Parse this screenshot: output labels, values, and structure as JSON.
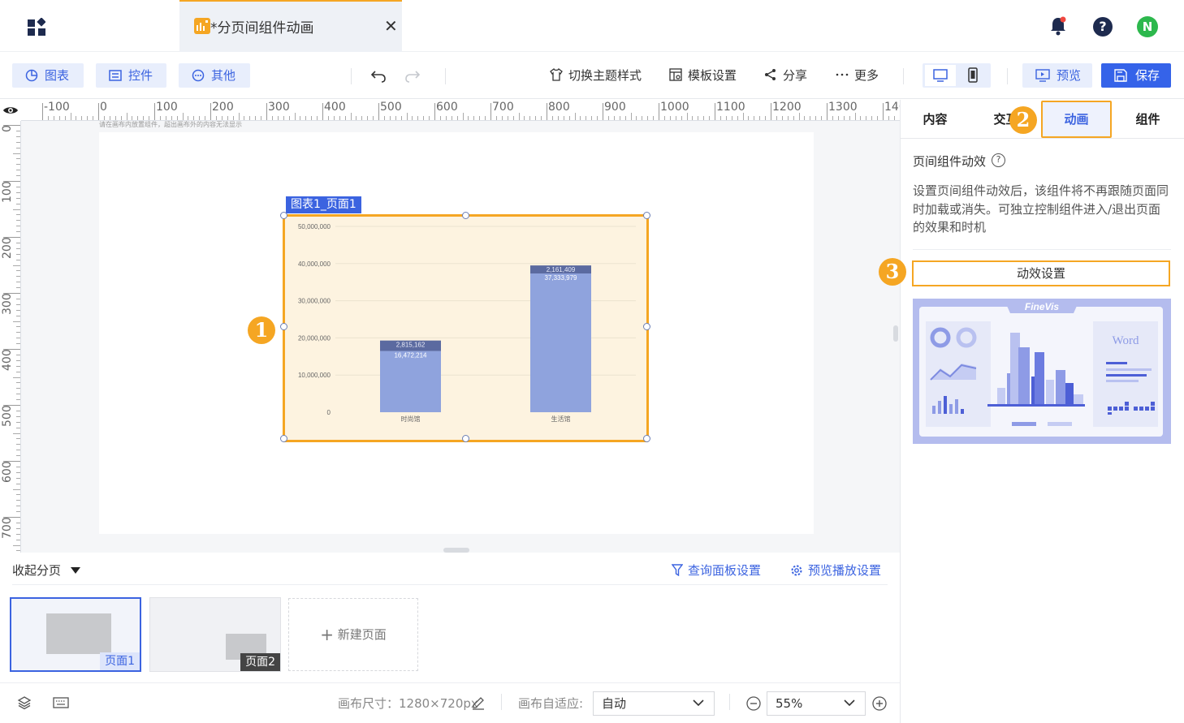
{
  "header": {
    "tab_title": "*分页间组件动画",
    "close_glyph": "✕",
    "help_glyph": "?",
    "avatar_letter": "N"
  },
  "toolbar": {
    "chart_btn": "图表",
    "control_btn": "控件",
    "other_btn": "其他",
    "theme": "切换主题样式",
    "template": "模板设置",
    "share": "分享",
    "more": "更多",
    "preview": "预览",
    "save": "保存"
  },
  "ruler": {
    "h_labels": [
      "-100",
      "0",
      "100",
      "200",
      "300",
      "400",
      "500",
      "600",
      "700",
      "800",
      "900",
      "1000",
      "1100",
      "1200",
      "1300",
      "140"
    ],
    "v_labels": [
      "0",
      "100",
      "200",
      "300",
      "400",
      "500",
      "600",
      "700"
    ]
  },
  "canvas": {
    "hint": "请在画布内放置组件，超出画布外的内容无法显示",
    "component_label": "图表1_页面1"
  },
  "markers": {
    "m1": "1",
    "m2": "2",
    "m3": "3"
  },
  "chart_data": {
    "type": "bar",
    "stacked": true,
    "categories": [
      "时尚馆",
      "生活馆"
    ],
    "series": [
      {
        "values": [
          16472214,
          37333979
        ]
      },
      {
        "values": [
          2815162,
          2161409
        ]
      }
    ],
    "data_labels": [
      [
        "16,472,214",
        "37,333,979"
      ],
      [
        "2,815,162",
        "2,161,409"
      ]
    ],
    "y_ticks": [
      "0",
      "10,000,000",
      "20,000,000",
      "30,000,000",
      "40,000,000",
      "50,000,000"
    ],
    "ylim": [
      0,
      50000000
    ],
    "colors": [
      "#8fa3dd",
      "#5b6aa0"
    ],
    "background": "#fdf3e0",
    "grid": true
  },
  "pages": {
    "collapse": "收起分页",
    "query_settings": "查询面板设置",
    "playback_settings": "预览播放设置",
    "page1": "页面1",
    "page2": "页面2",
    "new_page": "新建页面"
  },
  "bottom": {
    "canvas_size": "画布尺寸：1280×720px",
    "fit_label": "画布自适应:",
    "fit_value": "自动",
    "zoom": "55%"
  },
  "panel": {
    "tabs": [
      "内容",
      "交互",
      "动画",
      "组件"
    ],
    "section_title": "页间组件动效",
    "description": "设置页间组件动效后，该组件将不再跟随页面同时加载或消失。可独立控制组件进入/退出页面的效果和时机",
    "anim_button": "动效设置",
    "promo_title": "FineVis",
    "promo_word": "Word"
  }
}
